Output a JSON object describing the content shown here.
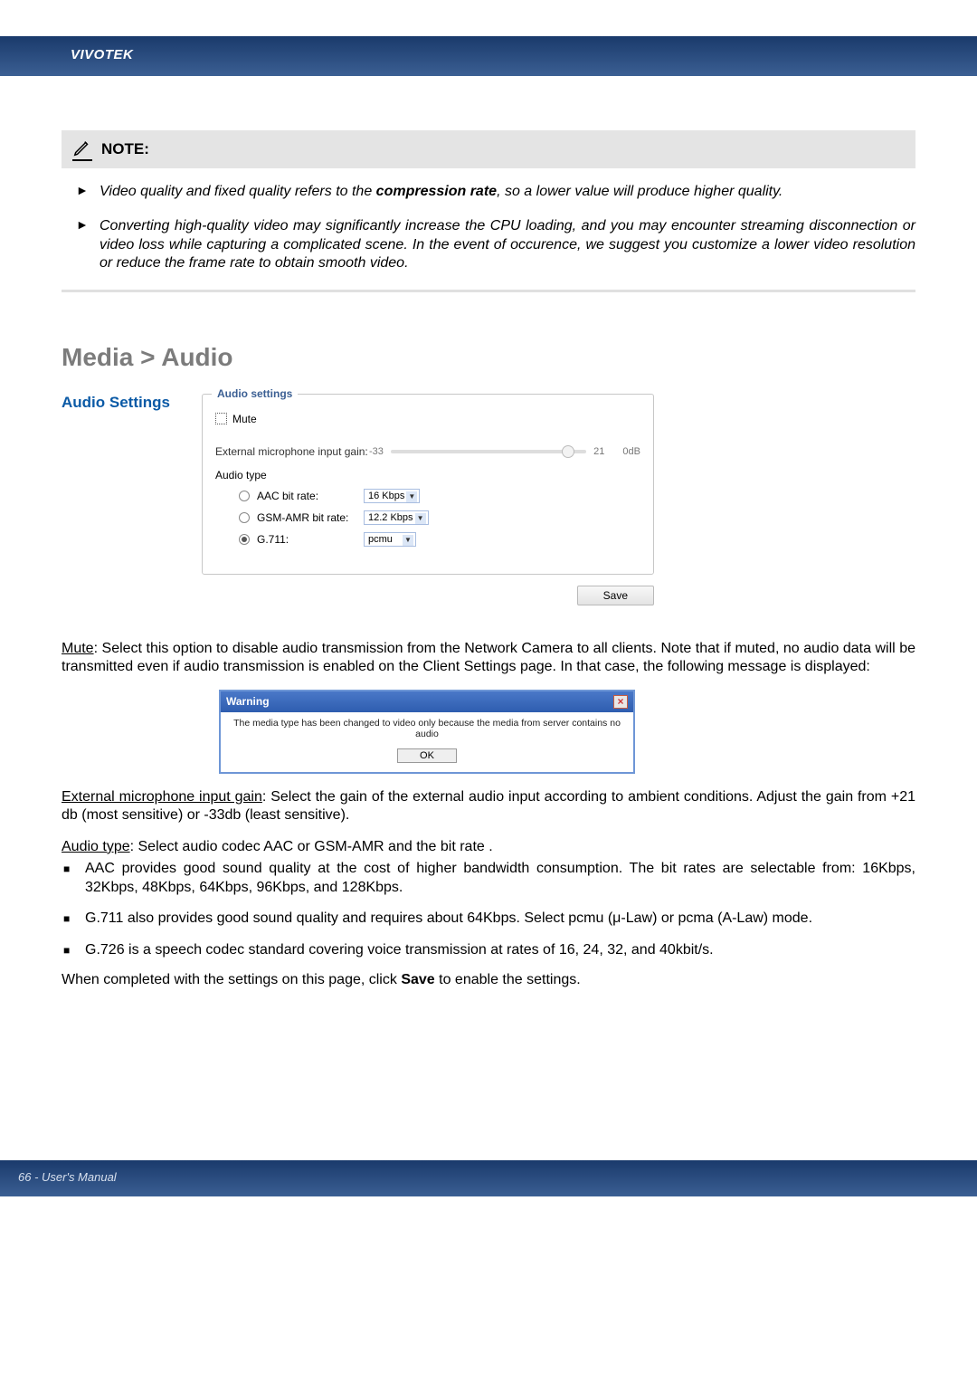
{
  "header": {
    "brand": "VIVOTEK"
  },
  "note": {
    "title": "NOTE:",
    "items": [
      {
        "pre": "Video quality and fixed quality refers to the ",
        "strong": "compression rate",
        "post": ", so a lower value will produce higher quality."
      },
      {
        "pre": "Converting high-quality video may significantly increase the CPU loading, and you may encounter streaming disconnection or video loss while capturing a complicated scene. In the event of occurence, we suggest you customize a lower video resolution or reduce the frame rate to obtain smooth video.",
        "strong": "",
        "post": ""
      }
    ]
  },
  "section": {
    "title": "Media > Audio",
    "subtitle": "Audio Settings"
  },
  "panel": {
    "legend": "Audio settings",
    "mute_label": "Mute",
    "gain_label": "External microphone input gain:",
    "gain_min": "-33",
    "gain_max": "21",
    "gain_unit": "0dB",
    "audio_type_label": "Audio type",
    "aac": {
      "label": "AAC bit rate:",
      "value": "16 Kbps"
    },
    "gsm": {
      "label": "GSM-AMR bit rate:",
      "value": "12.2 Kbps"
    },
    "g711": {
      "label": "G.711:",
      "value": "pcmu"
    },
    "save": "Save"
  },
  "body": {
    "mute_head": "Mute",
    "mute_text": ": Select this option to disable audio transmission from the Network Camera to all clients. Note that if muted, no audio data will be transmitted even if audio transmission is enabled on the Client Settings page. In that case, the following message is displayed:",
    "dialog": {
      "title": "Warning",
      "msg": "The media type has been changed to video only because the media from server contains no audio",
      "ok": "OK"
    },
    "gain_head": "External microphone input gain",
    "gain_text": ": Select the gain of the external audio input according to ambient conditions. Adjust the gain from +21 db (most sensitive) or -33db (least sensitive).",
    "type_head": "Audio type",
    "type_text": ": Select audio codec AAC or GSM-AMR and the bit rate .",
    "sq_items": [
      "AAC provides good sound quality at the cost of higher bandwidth consumption. The bit rates are selectable from: 16Kbps, 32Kbps, 48Kbps, 64Kbps, 96Kbps, and 128Kbps.",
      "G.711 also provides good sound quality and requires about 64Kbps. Select pcmu (μ-Law) or pcma (A-Law) mode.",
      "G.726 is a speech codec standard covering voice transmission at rates of 16, 24, 32, and 40kbit/s."
    ],
    "closing_pre": "When completed with the settings on this page, click ",
    "closing_strong": "Save",
    "closing_post": " to enable the settings."
  },
  "footer": {
    "text": "66 - User's Manual"
  }
}
